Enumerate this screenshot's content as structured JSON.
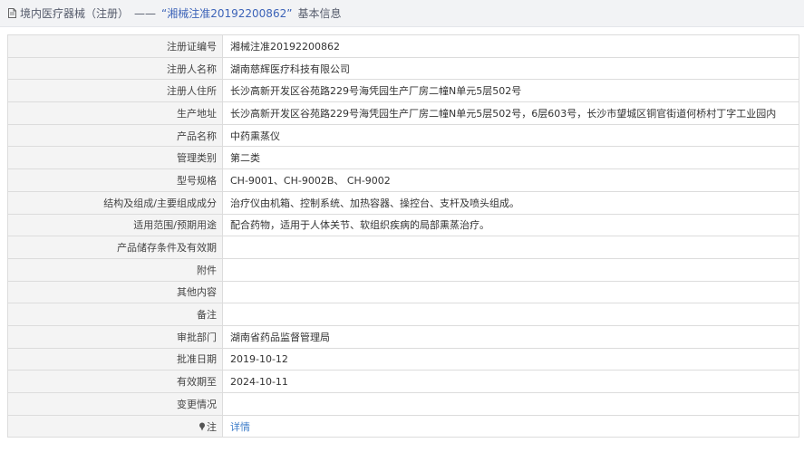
{
  "header": {
    "breadcrumb": "境内医疗器械（注册）",
    "separator": "——",
    "title": "“湘械注准20192200862”",
    "suffix": "基本信息"
  },
  "rows": [
    {
      "label": "注册证编号",
      "value": "湘械注准20192200862"
    },
    {
      "label": "注册人名称",
      "value": "湖南慈辉医疗科技有限公司"
    },
    {
      "label": "注册人住所",
      "value": "长沙高新开发区谷苑路229号海凭园生产厂房二幢N单元5层502号"
    },
    {
      "label": "生产地址",
      "value": "长沙高新开发区谷苑路229号海凭园生产厂房二幢N单元5层502号，6层603号，长沙市望城区铜官街道何桥村丁字工业园内"
    },
    {
      "label": "产品名称",
      "value": "中药熏蒸仪"
    },
    {
      "label": "管理类别",
      "value": "第二类"
    },
    {
      "label": "型号规格",
      "value": "CH-9001、CH-9002B、 CH-9002"
    },
    {
      "label": "结构及组成/主要组成成分",
      "value": "治疗仪由机箱、控制系统、加热容器、操控台、支杆及喷头组成。"
    },
    {
      "label": "适用范围/预期用途",
      "value": "配合药物，适用于人体关节、软组织疾病的局部熏蒸治疗。"
    },
    {
      "label": "产品储存条件及有效期",
      "value": ""
    },
    {
      "label": "附件",
      "value": ""
    },
    {
      "label": "其他内容",
      "value": ""
    },
    {
      "label": "备注",
      "value": ""
    },
    {
      "label": "审批部门",
      "value": "湖南省药品监督管理局"
    },
    {
      "label": "批准日期",
      "value": "2019-10-12"
    },
    {
      "label": "有效期至",
      "value": "2024-10-11"
    },
    {
      "label": "变更情况",
      "value": ""
    }
  ],
  "note_row": {
    "label": "注",
    "link": "详情"
  },
  "colors": {
    "link": "#3c7cc9",
    "title_accent": "#3c63b8",
    "label_bg": "#f4f4f4",
    "border": "#dcdcdc"
  }
}
